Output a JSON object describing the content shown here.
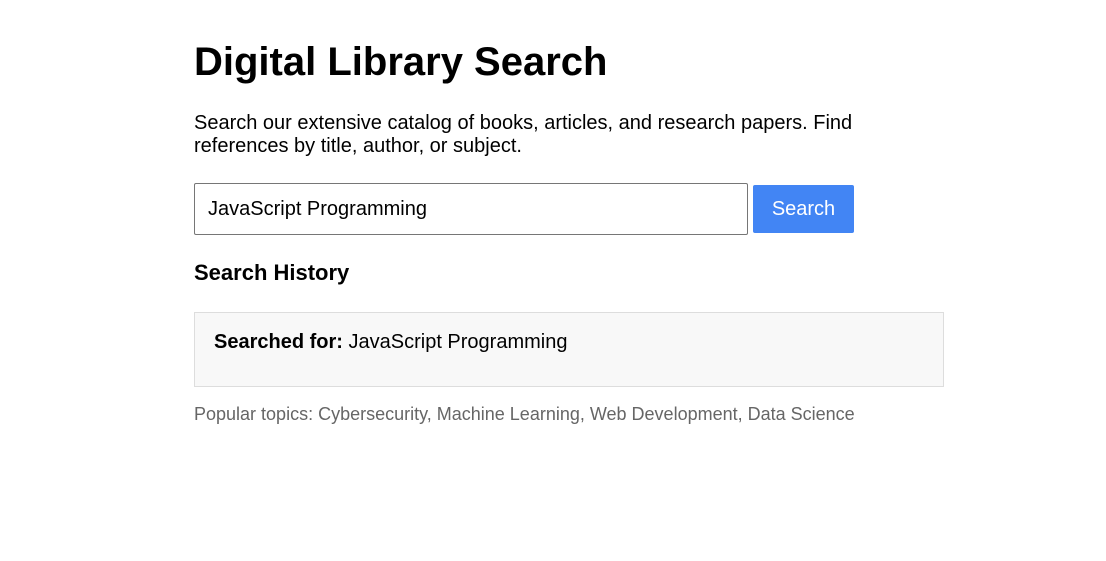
{
  "header": {
    "title": "Digital Library Search",
    "description": "Search our extensive catalog of books, articles, and research papers. Find references by title, author, or subject."
  },
  "search": {
    "value": "JavaScript Programming",
    "button_label": "Search"
  },
  "history": {
    "heading": "Search History",
    "entries": [
      {
        "label": "Searched for:",
        "query": "JavaScript Programming"
      }
    ]
  },
  "popular_topics": "Popular topics: Cybersecurity, Machine Learning, Web Development, Data Science",
  "colors": {
    "button_background": "#4285f4",
    "button_text": "#ffffff",
    "history_background": "#f8f8f8",
    "muted_text": "#666666"
  }
}
